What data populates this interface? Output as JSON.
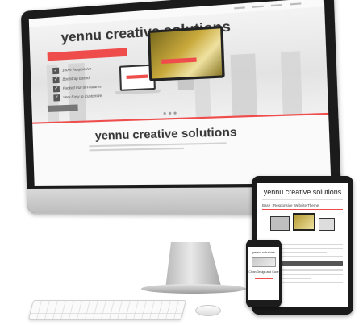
{
  "monitor_site": {
    "hero_title": "yennu creative solutions",
    "features": [
      "100% Responsive",
      "Bootstrap Based",
      "Packed Full of Features",
      "Very Easy to Customize"
    ],
    "section_title": "yennu creative solutions"
  },
  "tablet_site": {
    "title": "yennu creative solutions",
    "subtitle": "Base : Responsive Website Theme"
  },
  "phone_site": {
    "title": "yennu solutions",
    "text": "Clean Design and Code"
  },
  "colors": {
    "accent": "#ef4c4c",
    "device_black": "#1b1b1b"
  }
}
